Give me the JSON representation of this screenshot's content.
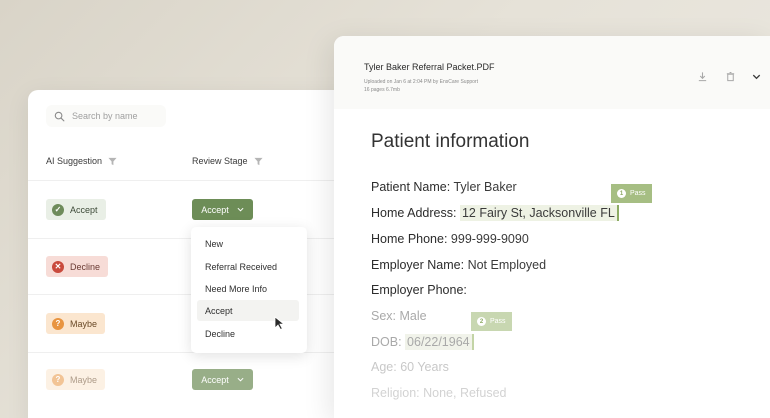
{
  "left_panel": {
    "search": {
      "placeholder": "Search by name"
    },
    "columns": {
      "ai_suggestion": "AI Suggestion",
      "review_stage": "Review Stage"
    },
    "rows": [
      {
        "ai_suggestion": "Accept",
        "review_stage": "Accept"
      },
      {
        "ai_suggestion": "Decline"
      },
      {
        "ai_suggestion": "Maybe"
      },
      {
        "ai_suggestion": "Maybe",
        "review_stage": "Accept"
      }
    ],
    "dropdown": {
      "items": [
        "New",
        "Referral Received",
        "Need More Info",
        "Accept",
        "Decline"
      ],
      "hovered": "Accept"
    }
  },
  "document": {
    "title": "Tyler Baker Referral Packet.PDF",
    "meta_line1": "Uploaded on Jan 6 at 2:04 PM by EnsCare Support",
    "meta_line2": "16 pages 6.7mb",
    "heading": "Patient information",
    "fields": {
      "patient_name": {
        "label": "Patient Name:",
        "value": "Tyler Baker"
      },
      "home_address": {
        "label": "Home Address:",
        "value": "12 Fairy St, Jacksonville FL"
      },
      "home_phone": {
        "label": "Home Phone:",
        "value": "999-999-9090"
      },
      "employer_name": {
        "label": "Employer Name:",
        "value": "Not Employed"
      },
      "employer_phone": {
        "label": "Employer Phone:",
        "value": ""
      },
      "sex": {
        "label": "Sex:",
        "value": "Male"
      },
      "dob": {
        "label": "DOB:",
        "value": "06/22/1964"
      },
      "age": {
        "label": "Age:",
        "value": "60 Years"
      },
      "religion": {
        "label": "Religion:",
        "value": "None, Refused"
      }
    },
    "pass_tags": [
      {
        "number": "1",
        "label": "Pass"
      },
      {
        "number": "2",
        "label": "Pass"
      }
    ]
  },
  "colors": {
    "accent_green": "#6d8d57",
    "pass_green": "#a6be83",
    "decline_red": "#c94a3d",
    "maybe_orange": "#e89440"
  },
  "icons": [
    "search-icon",
    "filter-icon",
    "check-icon",
    "x-icon",
    "question-icon",
    "chevron-down-icon",
    "cursor-icon",
    "download-icon",
    "trash-icon"
  ]
}
